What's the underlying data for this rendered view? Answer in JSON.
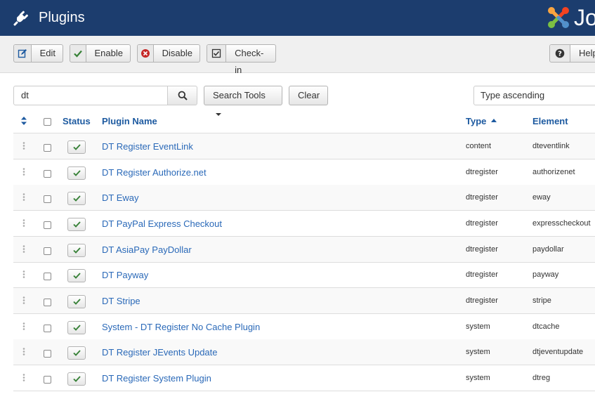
{
  "header": {
    "title": "Plugins",
    "logo_text": "Jo"
  },
  "toolbar": {
    "edit_label": "Edit",
    "enable_label": "Enable",
    "disable_label": "Disable",
    "checkin_label": "Check-in",
    "help_label": "Help"
  },
  "search": {
    "value": "dt",
    "search_tools_label": "Search Tools",
    "clear_label": "Clear",
    "sort_value": "Type ascending"
  },
  "table": {
    "columns": {
      "status": "Status",
      "name": "Plugin Name",
      "type": "Type",
      "element": "Element"
    },
    "rows": [
      {
        "name": "DT Register EventLink",
        "type": "content",
        "element": "dteventlink"
      },
      {
        "name": "DT Register Authorize.net",
        "type": "dtregister",
        "element": "authorizenet"
      },
      {
        "name": "DT Eway",
        "type": "dtregister",
        "element": "eway"
      },
      {
        "name": "DT PayPal Express Checkout",
        "type": "dtregister",
        "element": "expresscheckout"
      },
      {
        "name": "DT AsiaPay PayDollar",
        "type": "dtregister",
        "element": "paydollar"
      },
      {
        "name": "DT Payway",
        "type": "dtregister",
        "element": "payway"
      },
      {
        "name": "DT Stripe",
        "type": "dtregister",
        "element": "stripe"
      },
      {
        "name": "System - DT Register No Cache Plugin",
        "type": "system",
        "element": "dtcache"
      },
      {
        "name": "DT Register JEvents Update",
        "type": "system",
        "element": "dtjeventupdate"
      },
      {
        "name": "DT Register System Plugin",
        "type": "system",
        "element": "dtreg"
      }
    ]
  },
  "colors": {
    "header_bg": "#1c3d6e",
    "link": "#2a69b8",
    "enabled_check": "#378137",
    "disable_icon": "#c52827"
  }
}
